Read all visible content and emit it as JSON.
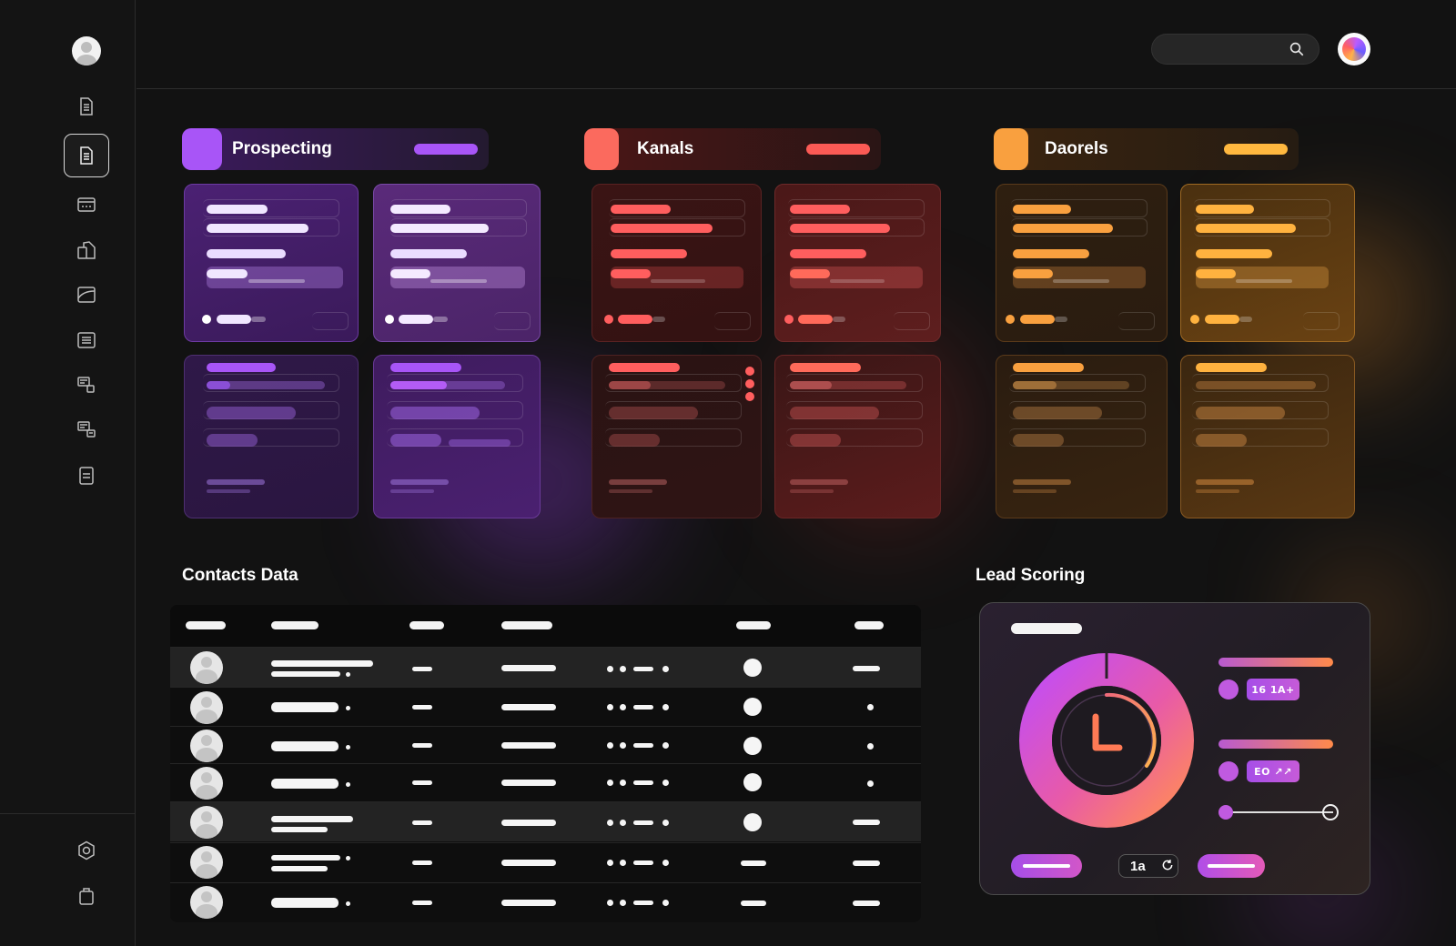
{
  "topbar": {
    "search_placeholder": ""
  },
  "columns": [
    {
      "title": "Prospecting",
      "color": "#a855f7"
    },
    {
      "title": "Kanals",
      "color": "#fb6a5e"
    },
    {
      "title": "Daorels",
      "color": "#f9a03f"
    }
  ],
  "sections": {
    "contacts_title": "Contacts Data",
    "lead_title": "Lead Scoring"
  },
  "lead_scoring": {
    "tag_1": "16 1A+",
    "tag_2": "EO ↗↗",
    "counter": "1a",
    "slider_value": 0
  },
  "icons": {
    "sidebar": [
      "user-avatar",
      "document-icon",
      "document-active-icon",
      "card-icon",
      "devices-icon",
      "folder-icon",
      "list-icon",
      "window-list-icon",
      "window-stack-icon",
      "note-icon",
      "settings-icon",
      "bag-icon"
    ],
    "top": [
      "search-icon",
      "profile-avatar"
    ]
  }
}
